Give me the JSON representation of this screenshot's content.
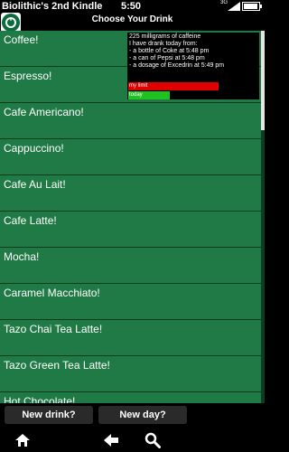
{
  "status_bar": {
    "device_name": "Biolithic's 2nd Kindle",
    "time": "5:50",
    "network": "3G",
    "icons": [
      "signal-icon",
      "battery-icon"
    ]
  },
  "header": {
    "title": "Choose Your Drink",
    "logo": "starbucks-logo-icon"
  },
  "drinks": [
    {
      "label": "Coffee!"
    },
    {
      "label": "Espresso!"
    },
    {
      "label": "Cafe Americano!"
    },
    {
      "label": "Cappuccino!"
    },
    {
      "label": "Cafe Au Lait!"
    },
    {
      "label": "Cafe Latte!"
    },
    {
      "label": "Mocha!"
    },
    {
      "label": "Caramel Macchiato!"
    },
    {
      "label": "Tazo Chai Tea Latte!"
    },
    {
      "label": "Tazo Green Tea Latte!"
    },
    {
      "label": "Hot Chocolate!"
    }
  ],
  "caffeine_panel": {
    "summary": "225 milligrams of caffeine",
    "intro": "I have drank today from:",
    "entries": [
      "- a bottle of Coke at 5:48 pm",
      "- a can of Pepsi at 5:48 pm",
      "- a dosage of Excedrin at 5:49 pm"
    ],
    "limit_label": "my limit",
    "today_label": "today",
    "today_fraction_of_limit": 0.46,
    "colors": {
      "limit": "#e00000",
      "today": "#1fc21f"
    }
  },
  "actions": {
    "new_drink": "New drink?",
    "new_day": "New day?"
  },
  "nav": {
    "icons": [
      "home-icon",
      "back-icon",
      "search-icon"
    ]
  },
  "colors": {
    "list_background": "#1f7a45",
    "divider": "#0b3a1f"
  }
}
